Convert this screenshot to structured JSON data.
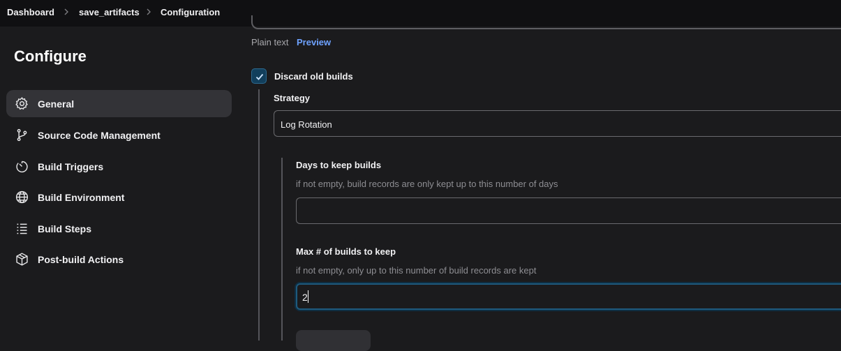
{
  "breadcrumb": {
    "items": [
      "Dashboard",
      "save_artifacts",
      "Configuration"
    ]
  },
  "sidebar": {
    "title": "Configure",
    "items": [
      {
        "label": "General",
        "icon": "gear-icon",
        "active": true
      },
      {
        "label": "Source Code Management",
        "icon": "branch-icon",
        "active": false
      },
      {
        "label": "Build Triggers",
        "icon": "timer-icon",
        "active": false
      },
      {
        "label": "Build Environment",
        "icon": "globe-icon",
        "active": false
      },
      {
        "label": "Build Steps",
        "icon": "list-icon",
        "active": false
      },
      {
        "label": "Post-build Actions",
        "icon": "package-icon",
        "active": false
      }
    ]
  },
  "main": {
    "description_tabs": {
      "plain": "Plain text",
      "preview": "Preview"
    },
    "discard_old_builds": {
      "label": "Discard old builds",
      "checked": true
    },
    "strategy": {
      "label": "Strategy",
      "value": "Log Rotation"
    },
    "days_to_keep": {
      "label": "Days to keep builds",
      "help": "if not empty, build records are only kept up to this number of days",
      "value": ""
    },
    "max_builds": {
      "label": "Max # of builds to keep",
      "help": "if not empty, only up to this number of build records are kept",
      "value": "2"
    }
  },
  "colors": {
    "background": "#1b1b1d",
    "header": "#101012",
    "accent_link": "#6ea2ff",
    "checkbox_fill": "#123f5c"
  }
}
